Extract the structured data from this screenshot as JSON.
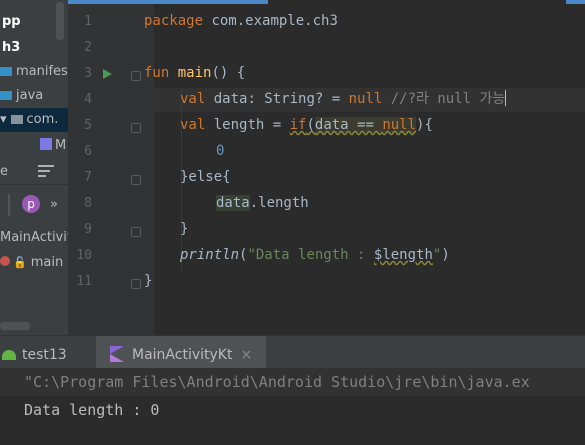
{
  "sidebar": {
    "project_partial": "pp",
    "module_partial": "h3",
    "items": [
      {
        "label": "manifes"
      },
      {
        "label": "java"
      },
      {
        "label": "com."
      },
      {
        "label": "M"
      }
    ],
    "structure_label": "e",
    "toolbar_overflow": "»",
    "tree": [
      {
        "label": "MainActivit"
      },
      {
        "label": "main"
      }
    ]
  },
  "editor": {
    "line_numbers": [
      "1",
      "2",
      "3",
      "4",
      "5",
      "6",
      "7",
      "8",
      "9",
      "10",
      "11"
    ],
    "lines": {
      "l1_kw": "package",
      "l1_rest": " com.example.ch3",
      "l3_kw": "fun",
      "l3_name": "main",
      "l3_rest": "() {",
      "l4_kw": "val",
      "l4_mid": " data: String? = ",
      "l4_null": "null",
      "l4_comment": " //?라 null 가능",
      "l5_kw": "val",
      "l5_mid": " length = ",
      "l5_if": "if",
      "l5_paren": "(",
      "l5_cond1": "data == ",
      "l5_null": "null",
      "l5_end": "){",
      "l6_num": "0",
      "l7": "}else{",
      "l8_data": "data",
      "l8_rest": ".length",
      "l9": "}",
      "l10_fn": "println",
      "l10_open": "(",
      "l10_str": "\"Data length : ",
      "l10_var": "$length",
      "l10_strend": "\"",
      "l10_close": ")",
      "l11": "}"
    }
  },
  "run_panel": {
    "tabs": [
      {
        "label": "test13"
      },
      {
        "label": "MainActivityKt",
        "close": "×"
      }
    ],
    "output": [
      "\"C:\\Program Files\\Android\\Android Studio\\jre\\bin\\java.ex",
      "Data length : 0"
    ]
  },
  "colors": {
    "keyword": "#cc7832",
    "function": "#ffc66d",
    "number": "#6897bb",
    "string": "#6a8759",
    "comment": "#808080",
    "run_icon": "#499c54"
  }
}
